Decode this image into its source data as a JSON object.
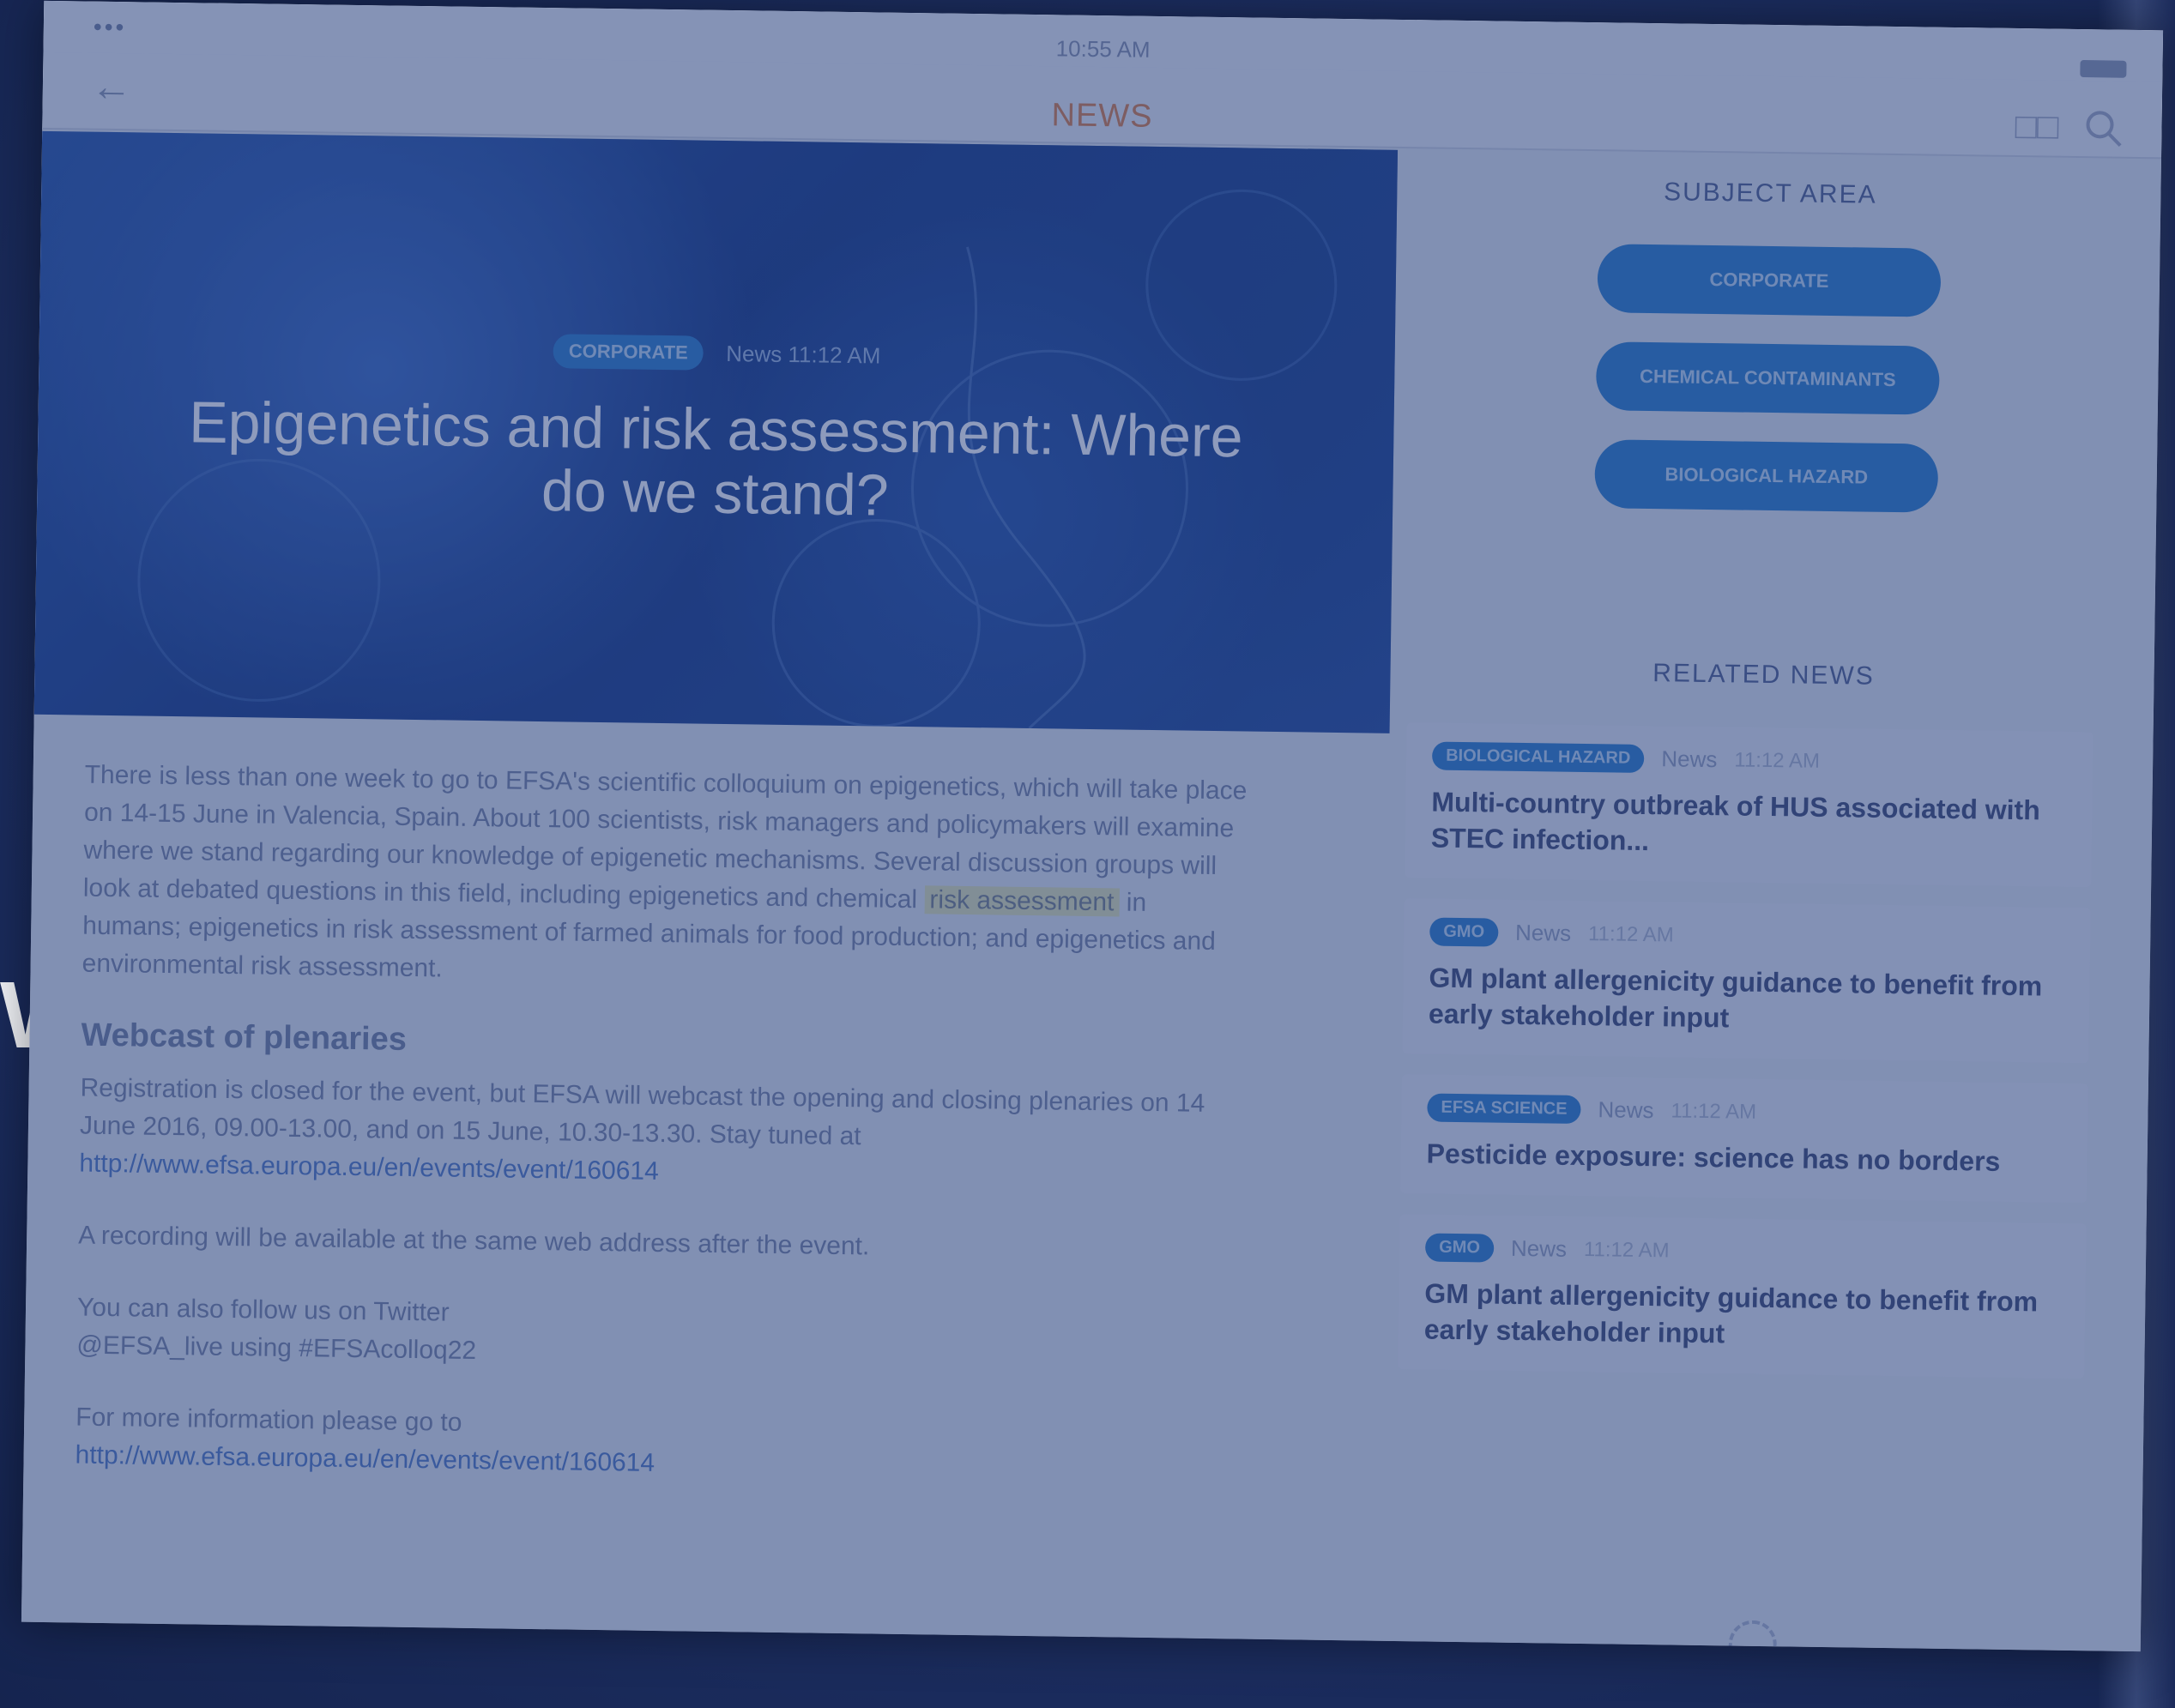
{
  "backdrop": {
    "side_word": "WS"
  },
  "status_bar": {
    "signal": "•••",
    "time": "10:55 AM"
  },
  "nav": {
    "back_glyph": "←",
    "title": "NEWS",
    "book_glyph": "□□"
  },
  "hero": {
    "tag": "CORPORATE",
    "kind": "News",
    "time": "11:12 AM",
    "title": "Epigenetics and risk assessment: Where do we stand?"
  },
  "article": {
    "para1_before": "There is less than one week to go to EFSA's scientific colloquium on epigenetics, which will take place on 14-15 June in Valencia, Spain. About 100 scientists, risk managers and policymakers will examine where we stand regarding our knowledge of epigenetic mechanisms. Several discussion groups will look at debated questions in this field, including epigenetics and chemical",
    "para1_highlight": "risk assessment",
    "para1_after": "in humans; epigenetics in risk assessment of farmed animals for food production; and epigenetics and environmental risk assessment.",
    "section_heading": "Webcast of plenaries",
    "para2": "Registration is closed for the event, but EFSA will webcast the opening and closing plenaries on 14 June 2016, 09.00-13.00, and on 15 June, 10.30-13.30. Stay tuned at",
    "link1": "http://www.efsa.europa.eu/en/events/event/160614",
    "para3": "A recording will be available at the same web address after the event.",
    "para4_line1": "You can also follow us on Twitter",
    "para4_line2": "@EFSA_live using #EFSAcolloq22",
    "para5": "For more information please go to",
    "link2": "http://www.efsa.europa.eu/en/events/event/160614"
  },
  "sidebar": {
    "subject_heading": "SUBJECT AREA",
    "subjects": [
      "CORPORATE",
      "CHEMICAL CONTAMINANTS",
      "BIOLOGICAL HAZARD"
    ],
    "related_heading": "RELATED NEWS",
    "related": [
      {
        "tag": "BIOLOGICAL HAZARD",
        "kind": "News",
        "time": "11:12 AM",
        "title": "Multi-country outbreak of HUS associated with STEC infection..."
      },
      {
        "tag": "GMO",
        "kind": "News",
        "time": "11:12 AM",
        "title": "GM plant allergenicity guidance to benefit from early stakeholder input"
      },
      {
        "tag": "EFSA Science",
        "kind": "News",
        "time": "11:12 AM",
        "title": "Pesticide exposure: science has no borders"
      },
      {
        "tag": "GMO",
        "kind": "News",
        "time": "11:12 AM",
        "title": "GM plant allergenicity guidance to benefit from early stakeholder input"
      }
    ]
  },
  "colors": {
    "overlay": "#1e346e",
    "accent": "#2d79c8",
    "nav_title": "#c17a5a",
    "link": "#4f76c0"
  },
  "icons": {
    "back": "arrow-left-icon",
    "book": "book-icon",
    "search": "search-icon",
    "spinner": "loading-icon"
  }
}
